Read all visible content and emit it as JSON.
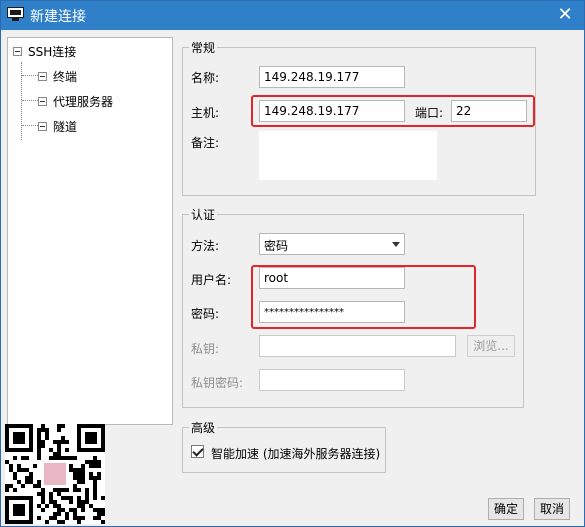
{
  "window": {
    "title": "新建连接",
    "close_glyph": "✕"
  },
  "tree": {
    "root": "SSH连接",
    "children": [
      "终端",
      "代理服务器",
      "隧道"
    ]
  },
  "general": {
    "legend": "常规",
    "name_label": "名称:",
    "name_value": "149.248.19.177",
    "host_label": "主机:",
    "host_value": "149.248.19.177",
    "port_label": "端口:",
    "port_value": "22",
    "note_label": "备注:",
    "note_value": ""
  },
  "auth": {
    "legend": "认证",
    "method_label": "方法:",
    "method_value": "密码",
    "username_label": "用户名:",
    "username_value": "root",
    "password_label": "密码:",
    "password_value": "****************",
    "key_label": "私钥:",
    "key_value": "",
    "browse_label": "浏览...",
    "key_password_label": "私钥密码:",
    "key_password_value": ""
  },
  "advanced": {
    "legend": "高级",
    "smart_accel_label": "智能加速 (加速海外服务器连接)",
    "smart_accel_checked": true
  },
  "buttons": {
    "ok": "确定",
    "cancel": "取消"
  },
  "colors": {
    "titlebar": "#2f80c8",
    "highlight": "#e3262b"
  },
  "icons": {
    "app": "terminal-monitor-icon",
    "close": "close-icon",
    "tree_toggle": "collapse-icon"
  }
}
